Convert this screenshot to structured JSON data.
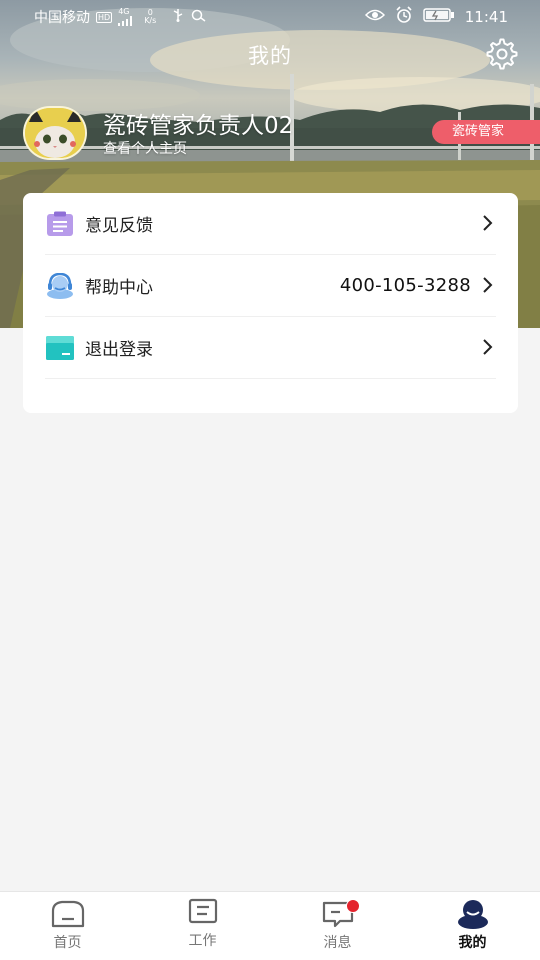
{
  "status_bar": {
    "carrier": "中国移动",
    "hd_badge": "HD",
    "network": "4G",
    "speed_value": "0",
    "speed_unit": "K/s",
    "time": "11:41"
  },
  "header": {
    "title": "我的"
  },
  "profile": {
    "name": "瓷砖管家负责人02",
    "subtitle": "查看个人主页",
    "role_badge": "瓷砖管家"
  },
  "menu": {
    "items": [
      {
        "label": "意见反馈",
        "value": "",
        "icon": "clipboard-icon"
      },
      {
        "label": "帮助中心",
        "value": "400-105-3288",
        "icon": "customer-service-icon"
      },
      {
        "label": "退出登录",
        "value": "",
        "icon": "logout-box-icon"
      }
    ]
  },
  "tabs": [
    {
      "label": "首页",
      "icon": "home-icon",
      "active": false
    },
    {
      "label": "工作",
      "icon": "work-icon",
      "active": false
    },
    {
      "label": "消息",
      "icon": "message-icon",
      "active": false
    },
    {
      "label": "我的",
      "icon": "profile-icon",
      "active": true
    }
  ],
  "colors": {
    "accent_badge": "#ee5e6a",
    "active_tab": "#1c2a5a",
    "feedback_icon": "#a98be0",
    "help_icon": "#6aa8e6",
    "logout_icon": "#37c9c9",
    "notification_dot": "#e4232d"
  }
}
